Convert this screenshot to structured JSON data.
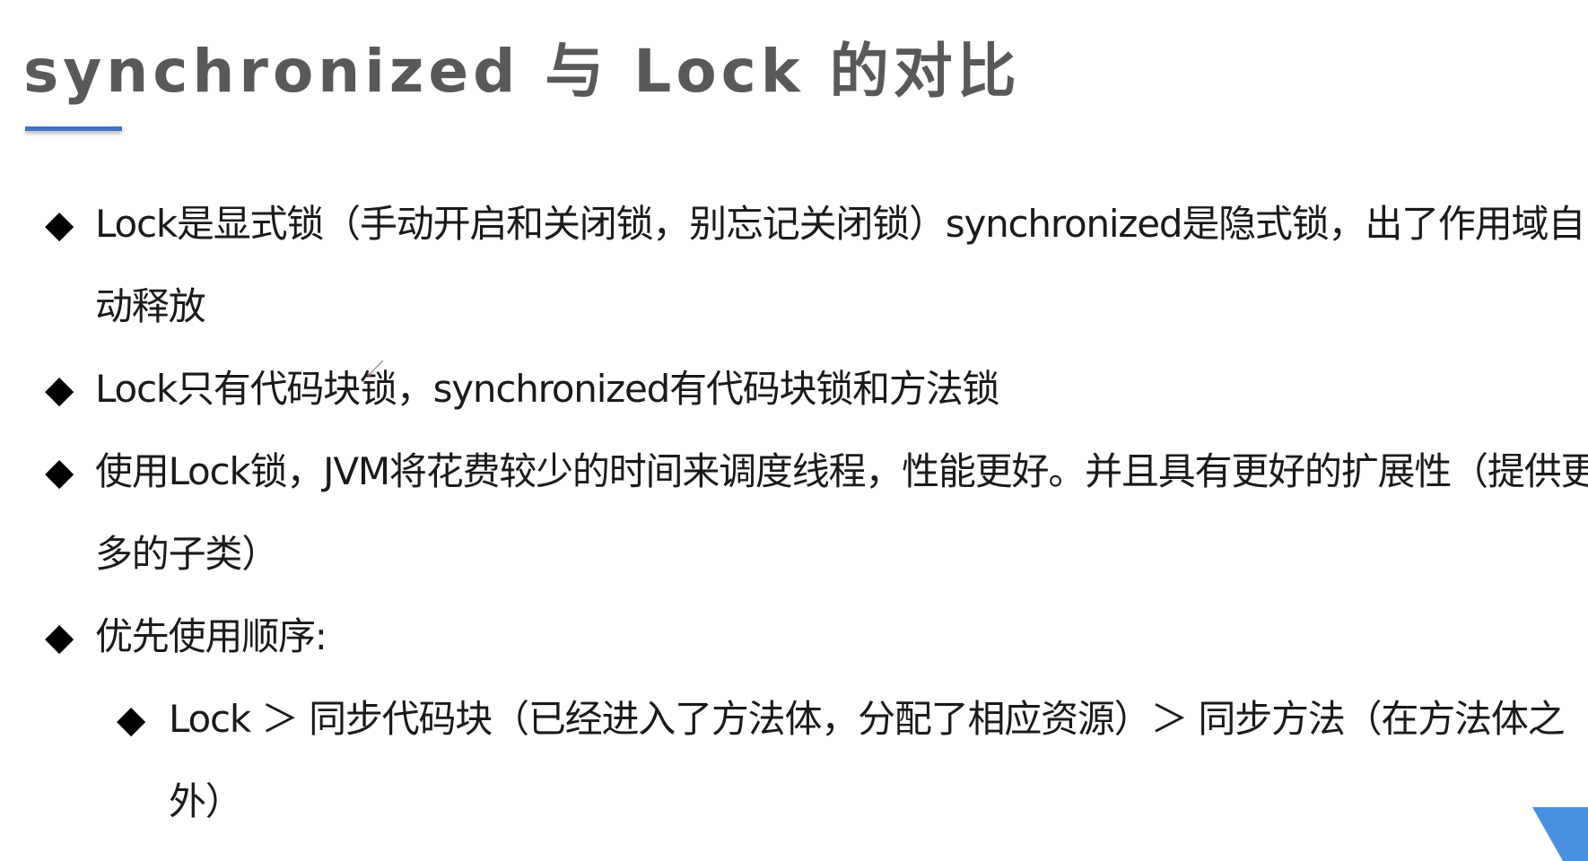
{
  "slide": {
    "title": "synchronized 与 Lock 的对比",
    "bullet_symbol": "◆",
    "bullets": [
      "Lock是显式锁（手动开启和关闭锁，别忘记关闭锁）synchronized是隐式锁，出了作用域自动释放",
      "Lock只有代码块锁，synchronized有代码块锁和方法锁",
      "使用Lock锁，JVM将花费较少的时间来调度线程，性能更好。并且具有更好的扩展性（提供更多的子类）",
      "优先使用顺序:"
    ],
    "sub_bullets": [
      "Lock ＞ 同步代码块（已经进入了方法体，分配了相应资源）＞ 同步方法（在方法体之外）"
    ]
  },
  "colors": {
    "title": "#595959",
    "accent_line": "#4472c4",
    "corner_shape": "#4a90e2",
    "text": "#1a1a1a"
  },
  "icons": {
    "bullet": "diamond-bullet-icon",
    "corner": "corner-triangle-decoration",
    "cursor": "pen-cursor-icon"
  }
}
